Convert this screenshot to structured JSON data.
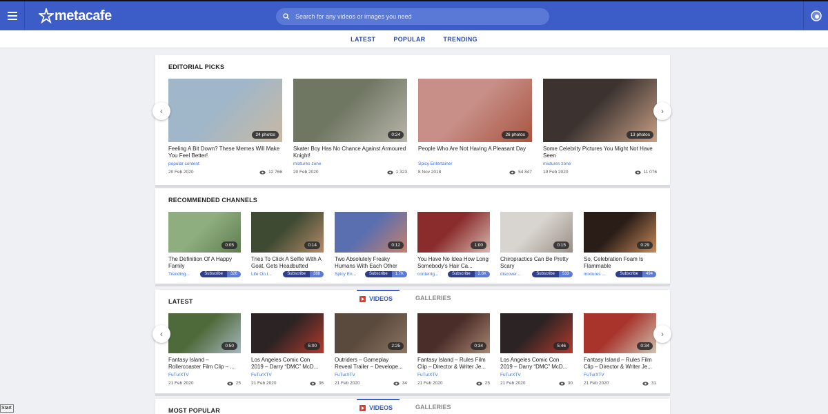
{
  "header": {
    "logo_text": "metacafe",
    "search_placeholder": "Search for any videos or images you need"
  },
  "nav": [
    "LATEST",
    "POPULAR",
    "TRENDING"
  ],
  "editorial": {
    "title": "EDITORIAL PICKS",
    "cards": [
      {
        "title": "Feeling A Bit Down? These Memes Will Make You Feel Better!",
        "source": "popular content",
        "date": "20 Feb 2020",
        "views": "12 766",
        "badge": "24 photos",
        "color1": "#9fb7c9",
        "color2": "#c9b8a3"
      },
      {
        "title": "Skater Boy Has No Chance Against Armoured Knight!",
        "source": "mixtures zone",
        "date": "20 Feb 2020",
        "views": "1 323",
        "badge": "0:24",
        "color1": "#6f7762",
        "color2": "#b9b6ab"
      },
      {
        "title": "People Who Are Not Having A Pleasant Day",
        "source": "Spicy Entertainer",
        "date": "8 Nov 2018",
        "views": "54 847",
        "badge": "26 photos",
        "color1": "#c88f88",
        "color2": "#a8553f"
      },
      {
        "title": "Some Celebrity Pictures You Might Not Have Seen",
        "source": "mixtures zone",
        "date": "19 Feb 2020",
        "views": "11 076",
        "badge": "13 photos",
        "color1": "#3c3330",
        "color2": "#c9a086"
      }
    ]
  },
  "channels": {
    "title": "RECOMMENDED CHANNELS",
    "subscribe_label": "Subscribe",
    "cards": [
      {
        "title": "The Definition Of A Happy Family",
        "channel": "Trending...",
        "count": "326",
        "duration": "0:05",
        "color1": "#8fae7f",
        "color2": "#5f7d4e"
      },
      {
        "title": "Tries To Click A Selfie With A Goat, Gets Headbutted",
        "channel": "Life On I...",
        "count": "388",
        "duration": "0:14",
        "color1": "#3f4a32",
        "color2": "#b58b6a"
      },
      {
        "title": "Two Absolutely Freaky Humans With Each Other",
        "channel": "Spicy En...",
        "count": "1.7K",
        "duration": "0:12",
        "color1": "#5a6fb0",
        "color2": "#c8806a"
      },
      {
        "title": "You Have No Idea How Long Somebody's Hair Ca...",
        "channel": "contentg...",
        "count": "2.6K",
        "duration": "1:00",
        "color1": "#8a2c2c",
        "color2": "#d9b9b0"
      },
      {
        "title": "Chiropractics Can Be Pretty Scary",
        "channel": "discover...",
        "count": "533",
        "duration": "0:15",
        "color1": "#d8d4cf",
        "color2": "#9a8f86"
      },
      {
        "title": "So, Celebration Foam Is Flammable",
        "channel": "mixtures ...",
        "count": "494",
        "duration": "0:29",
        "color1": "#2a1d18",
        "color2": "#c98a5a"
      }
    ]
  },
  "latest": {
    "title": "LATEST",
    "tab_videos": "VIDEOS",
    "tab_galleries": "GALLERIES",
    "cards": [
      {
        "title": "Fantasy Island – Rollercoaster Film Clip – ...",
        "source": "FuTurXTV",
        "date": "21 Feb 2020",
        "views": "25",
        "duration": "0:50",
        "color1": "#4f6a3a",
        "color2": "#a7b7c0"
      },
      {
        "title": "Los Angeles Comic Con 2019 – Darry “DMC” McD...",
        "source": "FuTurXTV",
        "date": "21 Feb 2020",
        "views": "36",
        "duration": "5:00",
        "color1": "#2c2424",
        "color2": "#b53a2e"
      },
      {
        "title": "Outriders – Gameplay Reveal Trailer – Develope...",
        "source": "FuTurXTV",
        "date": "21 Feb 2020",
        "views": "34",
        "duration": "2:25",
        "color1": "#5a4a3e",
        "color2": "#8e7561"
      },
      {
        "title": "Fantasy Island – Rules Film Clip – Director & Writer Je...",
        "source": "FuTurXTV",
        "date": "21 Feb 2020",
        "views": "25",
        "duration": "0:34",
        "color1": "#4a2c28",
        "color2": "#a88772"
      },
      {
        "title": "Los Angeles Comic Con 2019 – Darry “DMC” McD...",
        "source": "FuTurXTV",
        "date": "21 Feb 2020",
        "views": "30",
        "duration": "5:46",
        "color1": "#2c2424",
        "color2": "#b53a2e"
      },
      {
        "title": "Fantasy Island – Rules Film Clip – Director & Writer Je...",
        "source": "FuTurXTV",
        "date": "21 Feb 2020",
        "views": "31",
        "duration": "0:34",
        "color1": "#a8342c",
        "color2": "#cfc3b0"
      }
    ]
  },
  "popular": {
    "title": "MOST POPULAR",
    "tab_videos": "VIDEOS",
    "tab_galleries": "GALLERIES"
  },
  "taskbar": {
    "start_label": "Start"
  },
  "colors": {
    "brand": "#3c5cc7",
    "link": "#3c6ed6"
  }
}
